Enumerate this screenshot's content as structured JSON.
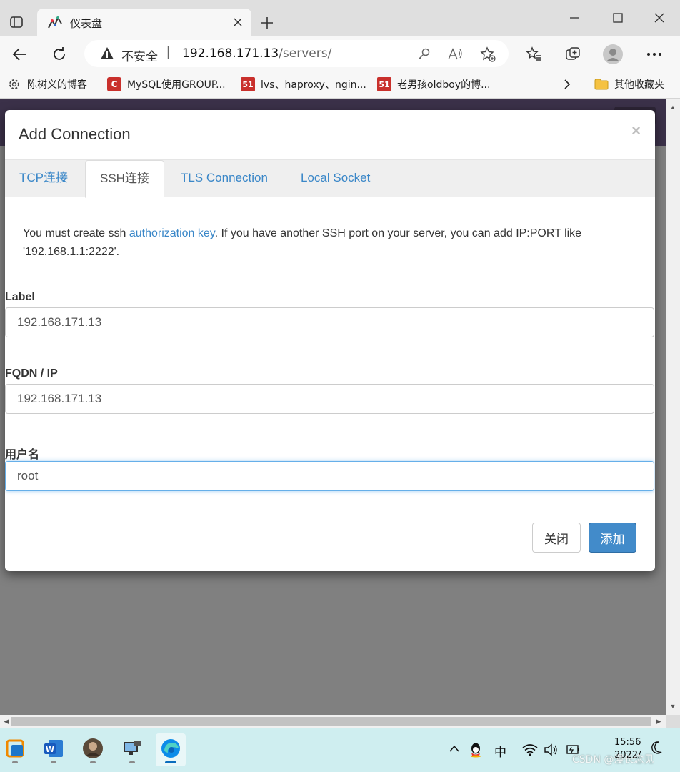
{
  "browser": {
    "tab": {
      "title": "仪表盘"
    },
    "address": {
      "insecure_label": "不安全",
      "separator": "|",
      "host": "192.168.171.13",
      "path": "/servers/"
    },
    "bookmarks": [
      {
        "label": "陈树义的博客",
        "icon": "gear-icon"
      },
      {
        "label": "MySQL使用GROUP...",
        "icon": "csdn-c-icon",
        "icon_text": "C"
      },
      {
        "label": "lvs、haproxy、ngin...",
        "icon": "51cto-icon",
        "icon_text": "51"
      },
      {
        "label": "老男孩oldboy的博...",
        "icon": "51cto-icon",
        "icon_text": "51"
      }
    ],
    "other_bookmarks": "其他收藏夹"
  },
  "modal": {
    "title": "Add Connection",
    "close_symbol": "×",
    "tabs": [
      {
        "label": "TCP连接",
        "active": false
      },
      {
        "label": "SSH连接",
        "active": true
      },
      {
        "label": "TLS Connection",
        "active": false
      },
      {
        "label": "Local Socket",
        "active": false
      }
    ],
    "help": {
      "before": "You must create ssh ",
      "link": "authorization key",
      "after": ". If you have another SSH port on your server, you can add IP:PORT like '192.168.1.1:2222'."
    },
    "fields": {
      "label": {
        "label": "Label",
        "value": "192.168.171.13"
      },
      "fqdn": {
        "label": "FQDN / IP",
        "value": "192.168.171.13"
      },
      "username": {
        "label": "用户名",
        "value": "root"
      }
    },
    "buttons": {
      "close": "关闭",
      "add": "添加"
    }
  },
  "taskbar": {
    "ime": "中",
    "time": "15:56",
    "date": "2022/"
  },
  "watermark": "CSDN @漫长念见",
  "colors": {
    "accent": "#428bca",
    "link": "#3a87c8",
    "page_bg": "#808080",
    "taskbar_bg": "#cfeef0"
  }
}
